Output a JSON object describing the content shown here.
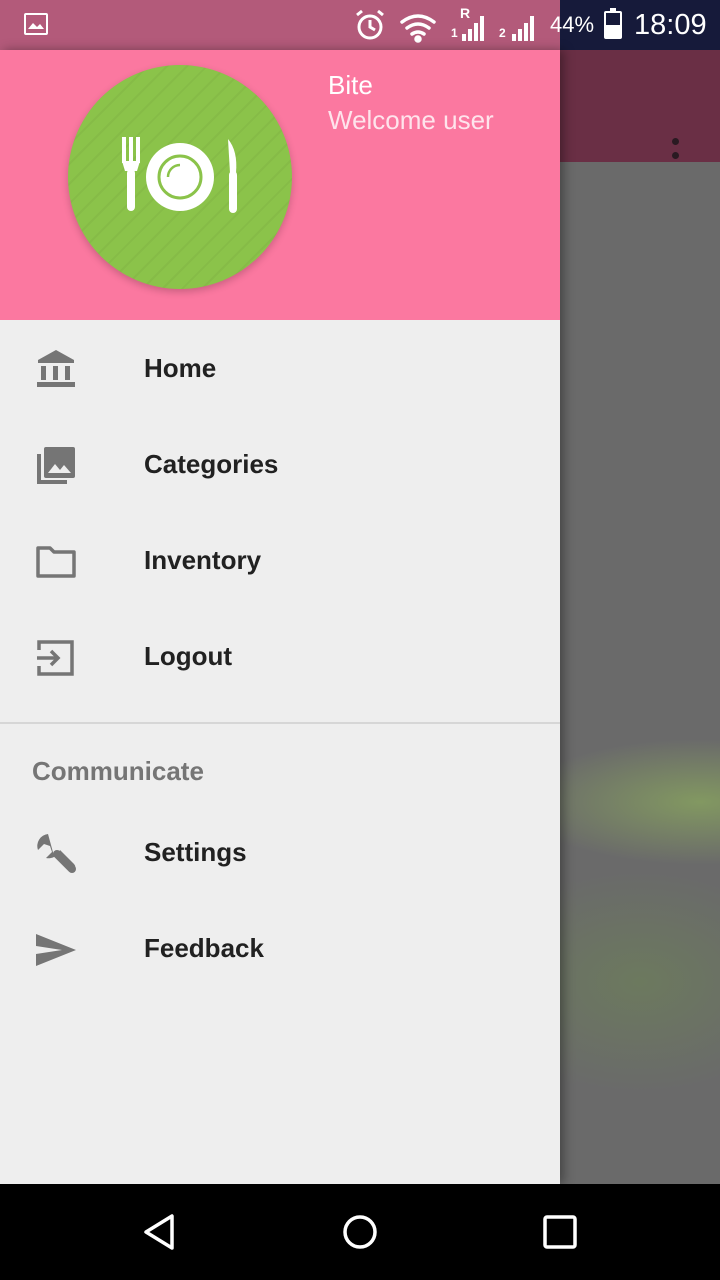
{
  "status_bar": {
    "battery": "44%",
    "time": "18:09",
    "signal_1_label": "R",
    "sim1": "1",
    "sim2": "2"
  },
  "drawer": {
    "header": {
      "title": "Bite",
      "subtitle": "Welcome user",
      "background_color": "#fb78a0",
      "logo_color": "#8bc34a"
    },
    "items": [
      {
        "label": "Home",
        "icon": "bank-icon"
      },
      {
        "label": "Categories",
        "icon": "photo-library-icon"
      },
      {
        "label": "Inventory",
        "icon": "folder-icon"
      },
      {
        "label": "Logout",
        "icon": "exit-icon"
      }
    ],
    "section": {
      "title": "Communicate",
      "items": [
        {
          "label": "Settings",
          "icon": "wrench-icon"
        },
        {
          "label": "Feedback",
          "icon": "send-icon"
        }
      ]
    }
  },
  "colors": {
    "toolbar": "#6a2f45",
    "drawer_bg": "#eeeeee",
    "icon_gray": "#757575"
  }
}
